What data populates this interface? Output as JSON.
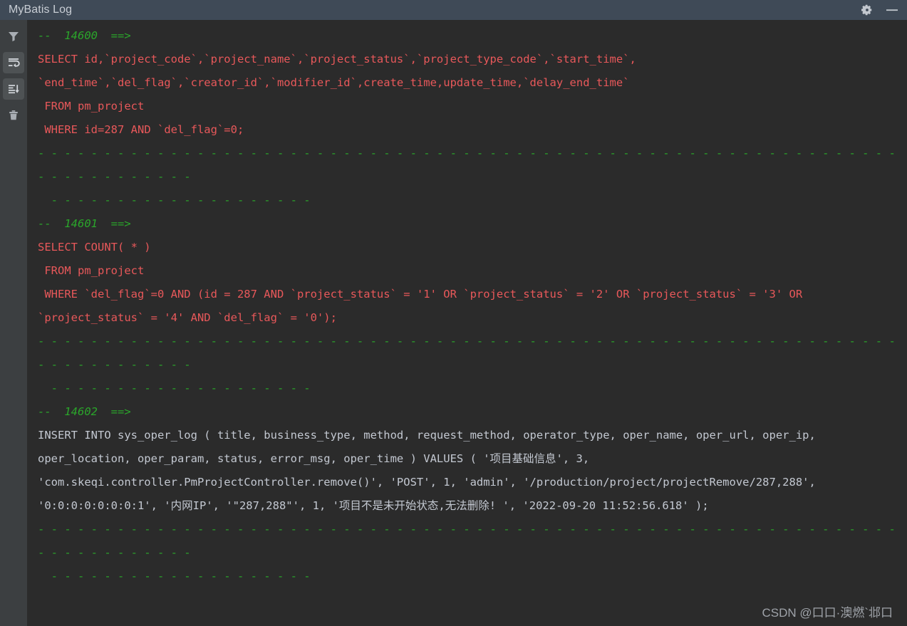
{
  "window": {
    "title": "MyBatis Log",
    "actions": [
      {
        "name": "settings-button",
        "icon": "gear-icon"
      },
      {
        "name": "minimize-button",
        "icon": "minimize-icon"
      }
    ]
  },
  "sidebar": {
    "items": [
      {
        "name": "filter-button",
        "icon": "filter-icon",
        "active": false
      },
      {
        "name": "soft-wrap-button",
        "icon": "soft-wrap-icon",
        "active": true
      },
      {
        "name": "scroll-to-end-button",
        "icon": "scroll-to-end-icon",
        "active": true
      },
      {
        "name": "clear-all-button",
        "icon": "trash-icon",
        "active": false
      }
    ]
  },
  "log": {
    "entries": [
      {
        "id": "14600",
        "header_prefix": "--",
        "header_arrow": "==>",
        "style": "sql",
        "lines": [
          "SELECT id,`project_code`,`project_name`,`project_status`,`project_type_code`,`start_time`, `end_time`,`del_flag`,`creator_id`,`modifier_id`,create_time,update_time,`delay_end_time`",
          " FROM pm_project",
          " WHERE id=287 AND `del_flag`=0;"
        ],
        "separator_long": "- - - - - - - - - - - - - - - - - - - - - - - - - - - - - - - - - - - - - - - - - - - - - - - - - - - - - - - - - - - - - - - - - - - - - - - - - - - - -",
        "separator_short": "  - - - - - - - - - - - - - - - - - - - -"
      },
      {
        "id": "14601",
        "header_prefix": "--",
        "header_arrow": "==>",
        "style": "sql",
        "lines": [
          "SELECT COUNT( * )",
          " FROM pm_project",
          " WHERE `del_flag`=0 AND (id = 287 AND `project_status` = '1' OR `project_status` = '2' OR `project_status` = '3' OR `project_status` = '4' AND `del_flag` = '0');"
        ],
        "separator_long": "- - - - - - - - - - - - - - - - - - - - - - - - - - - - - - - - - - - - - - - - - - - - - - - - - - - - - - - - - - - - - - - - - - - - - - - - - - - - -",
        "separator_short": "  - - - - - - - - - - - - - - - - - - - -"
      },
      {
        "id": "14602",
        "header_prefix": "--",
        "header_arrow": "==>",
        "style": "plain",
        "lines": [
          "INSERT INTO sys_oper_log ( title, business_type, method, request_method, operator_type, oper_name, oper_url, oper_ip, oper_location, oper_param, status, error_msg, oper_time ) VALUES ( '项目基础信息', 3, 'com.skeqi.controller.PmProjectController.remove()', 'POST', 1, 'admin', '/production/project/projectRemove/287,288', '0:0:0:0:0:0:0:1', '内网IP', '\"287,288\"', 1, '项目不是未开始状态,无法删除! ', '2022-09-20 11:52:56.618' );"
        ],
        "separator_long": "- - - - - - - - - - - - - - - - - - - - - - - - - - - - - - - - - - - - - - - - - - - - - - - - - - - - - - - - - - - - - - - - - - - - - - - - - - - - -",
        "separator_short": "  - - - - - - - - - - - - - - - - - - - -"
      }
    ]
  },
  "watermark": "CSDN @口口·澳燃`邶口",
  "colors": {
    "titlebar_bg": "#3f4a57",
    "sidebar_bg": "#3c3f41",
    "editor_bg": "#2b2b2b",
    "sql_text": "#e8585a",
    "plain_text": "#c3c8d1",
    "meta_green": "#2ba52b"
  }
}
